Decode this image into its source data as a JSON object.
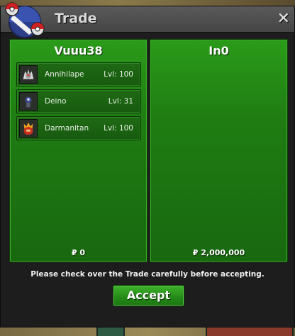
{
  "window": {
    "title": "Trade",
    "close_icon": "close-icon"
  },
  "left_panel": {
    "player": "Vuuu38",
    "money": "₽ 0",
    "pokemon": [
      {
        "name": "Annihilape",
        "level": "Lvl: 100",
        "icon": "annihilape-icon"
      },
      {
        "name": "Deino",
        "level": "Lvl: 31",
        "icon": "deino-icon"
      },
      {
        "name": "Darmanitan",
        "level": "Lvl: 100",
        "icon": "darmanitan-icon"
      }
    ]
  },
  "right_panel": {
    "player": "In0",
    "money": "₽ 2,000,000"
  },
  "notice": "Please check over the Trade carefully before accepting.",
  "accept_label": "Accept",
  "colors": {
    "panel_green": "#1f7d12",
    "button_green": "#248a17",
    "titlebar": "#4d4d4d"
  }
}
